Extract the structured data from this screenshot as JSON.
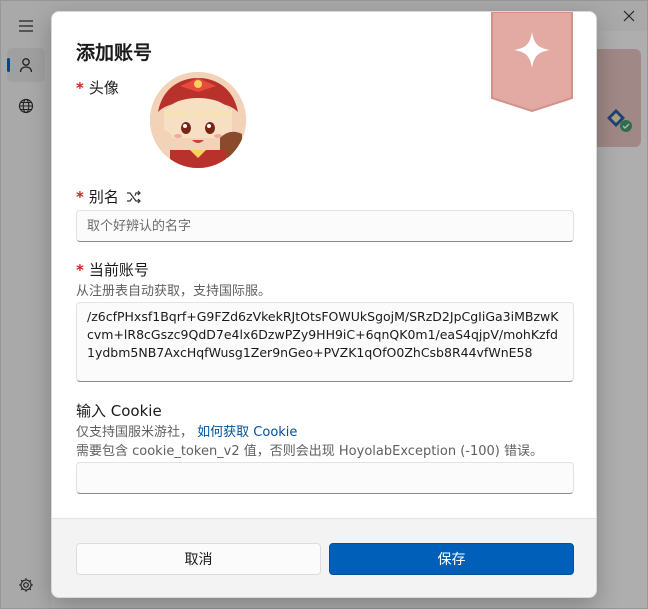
{
  "dialog": {
    "title": "添加账号",
    "avatar_label": "头像",
    "alias_label": "别名",
    "alias_placeholder": "取个好辨认的名字",
    "current_account_label": "当前账号",
    "current_account_hint": "从注册表自动获取，支持国际服。",
    "current_account_value": "/z6cfPHxsf1Bqrf+G9FZd6zVkekRJtOtsFOWUkSgojM/SRzD2JpCgIiGa3iMBzwKcvm+lR8cGszc9QdD7e4lx6DzwPZy9HH9iC+6qnQK0m1/eaS4qjpV/mohKzfd1ydbm5NB7AxcHqfWusg1Zer9nGeo+PVZK1qOfO0ZhCsb8R44vfWnE58",
    "cookie_label": "输入 Cookie",
    "cookie_hint_prefix": "仅支持国服米游社，",
    "cookie_hint_link": "如何获取 Cookie",
    "cookie_hint_line2": "需要包含 cookie_token_v2 值，否则会出现 HoyolabException (-100) 错误。",
    "cookie_value": "",
    "required_mark": "*",
    "cancel_label": "取消",
    "save_label": "保存"
  },
  "icons": {
    "menu": "hamburger-menu-icon",
    "account": "person-icon",
    "web": "globe-icon",
    "settings": "gear-icon",
    "close": "close-icon",
    "random": "shuffle-icon"
  },
  "colors": {
    "accent": "#005fb8",
    "required": "#c42b1c",
    "link": "#0050a0",
    "ribbon": "#e3a9a3"
  }
}
